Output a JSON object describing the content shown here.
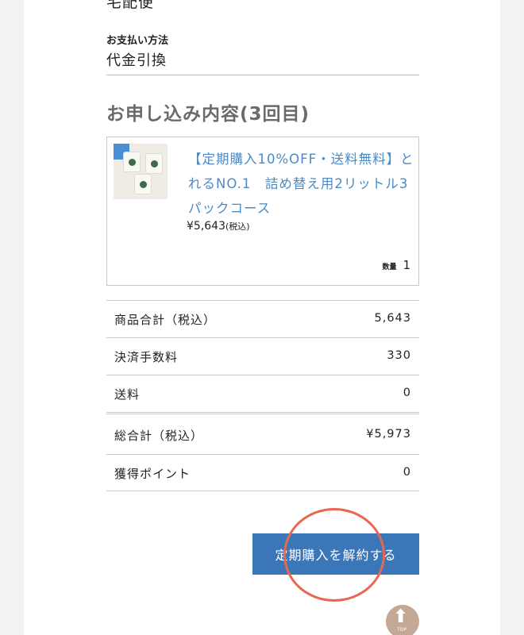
{
  "shipping": {
    "method_cut": "宅配便"
  },
  "payment": {
    "label": "お支払い方法",
    "value": "代金引換"
  },
  "order": {
    "title": "お申し込み内容(3回目)",
    "product": {
      "name": "【定期購入10%OFF・送料無料】とれるNO.1　詰め替え用2リットル3パックコース",
      "price": "¥5,643",
      "tax_note": "(税込)",
      "quantity_label": "数量",
      "quantity": "1"
    }
  },
  "summary": [
    {
      "label": "商品合計（税込）",
      "value": "5,643"
    },
    {
      "label": "決済手数料",
      "value": "330"
    },
    {
      "label": "送料",
      "value": "0"
    },
    {
      "label": "総合計（税込）",
      "value": "¥5,973"
    },
    {
      "label": "獲得ポイント",
      "value": "0"
    }
  ],
  "actions": {
    "cancel_label": "定期購入を解約する",
    "top_label": "TOP"
  },
  "colors": {
    "accent": "#3b77b8",
    "link": "#4b8ac4",
    "annotation": "#e8684f",
    "top_button": "#c4a896"
  }
}
